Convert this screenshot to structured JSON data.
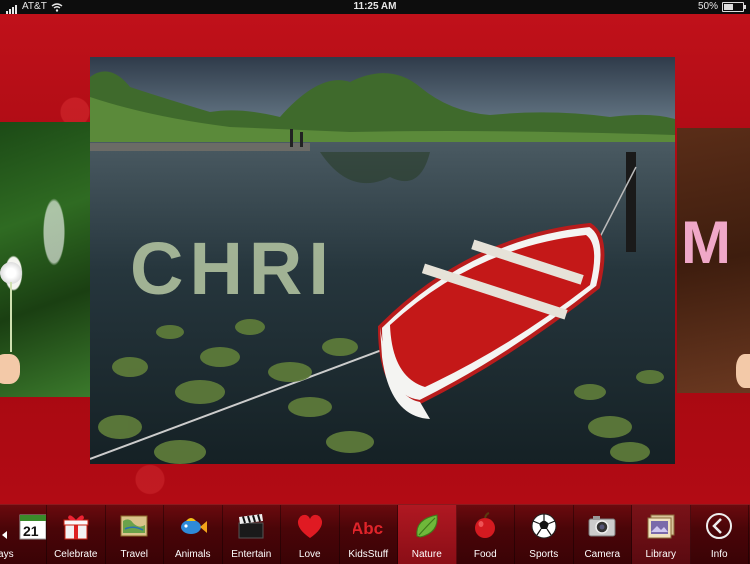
{
  "status_bar": {
    "carrier": "AT&T",
    "time": "11:25 AM",
    "battery": "50%",
    "battery_level": 0.5
  },
  "photo": {
    "lily_pad_text": "CHRI"
  },
  "side_right": {
    "letters": "M"
  },
  "toolbar": {
    "items": [
      {
        "label": "lidays",
        "icon": "calendar-icon"
      },
      {
        "label": "Celebrate",
        "icon": "gift-icon"
      },
      {
        "label": "Travel",
        "icon": "map-icon"
      },
      {
        "label": "Animals",
        "icon": "fish-icon"
      },
      {
        "label": "Entertain",
        "icon": "clapperboard-icon"
      },
      {
        "label": "Love",
        "icon": "heart-icon"
      },
      {
        "label": "KidsStuff",
        "icon": "abc-icon"
      },
      {
        "label": "Nature",
        "icon": "leaf-icon"
      },
      {
        "label": "Food",
        "icon": "apple-icon"
      },
      {
        "label": "Sports",
        "icon": "soccer-ball-icon"
      },
      {
        "label": "Camera",
        "icon": "camera-icon"
      },
      {
        "label": "Library",
        "icon": "photo-library-icon"
      },
      {
        "label": "Info",
        "icon": "back-arrow-icon"
      }
    ],
    "calendar_day": "21",
    "abc_text": "Abc",
    "active": "Nature"
  },
  "colors": {
    "background_red": "#b20b14",
    "toolbar_dark": "#4a0508",
    "active_tab": "#b01822",
    "heart": "#e01a22",
    "leaf": "#6fb83a"
  }
}
